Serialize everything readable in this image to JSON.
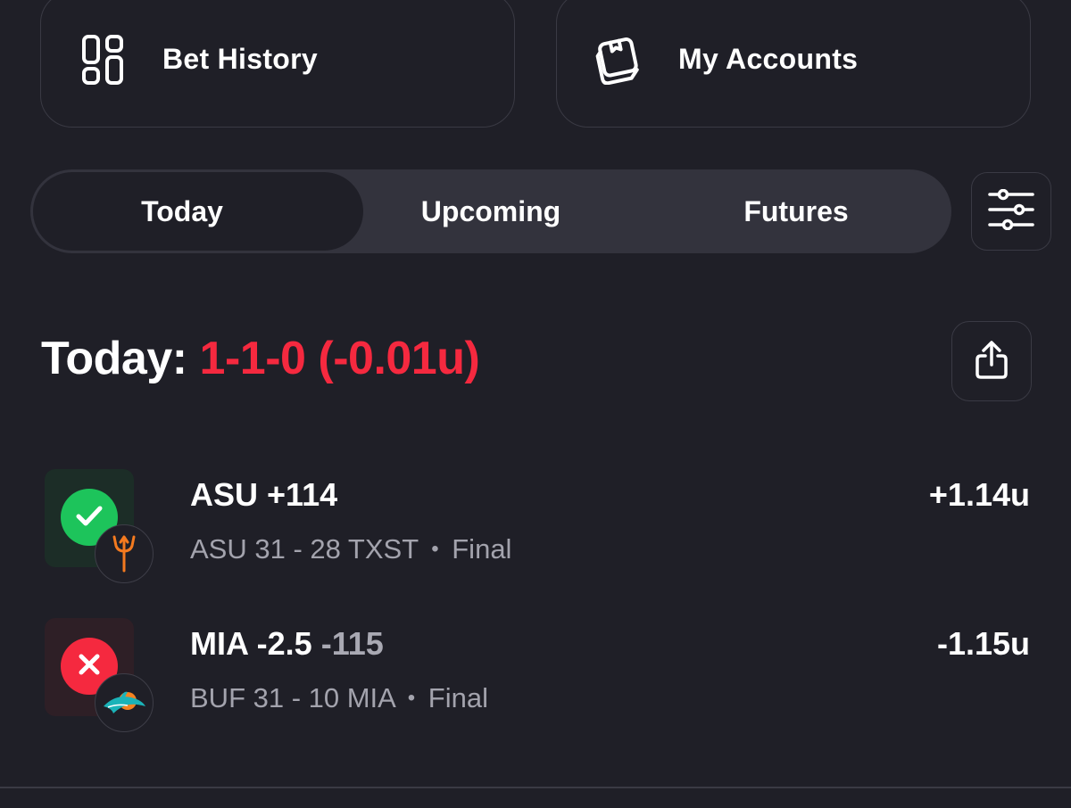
{
  "quick_links": {
    "bet_history_label": "Bet History",
    "my_accounts_label": "My Accounts",
    "bet_history_icon": "layout-grid-icon",
    "my_accounts_icon": "package-box-icon"
  },
  "tabs": {
    "items": [
      "Today",
      "Upcoming",
      "Futures"
    ],
    "active": "Today",
    "filter_icon": "sliders-icon"
  },
  "summary": {
    "label": "Today:",
    "record": "1-1-0 (-0.01u)",
    "share_icon": "share-icon"
  },
  "bets": [
    {
      "pick": "ASU +114",
      "pick_odds": "",
      "result_line": "ASU 31 - 28 TXST",
      "status": "Final",
      "units": "+1.14u",
      "outcome": "win",
      "outcome_icon": "check-icon",
      "team_logo": "asu-pitchfork-logo"
    },
    {
      "pick": "MIA -2.5 ",
      "pick_odds": "-115",
      "result_line": "BUF 31 - 10 MIA",
      "status": "Final",
      "units": "-1.15u",
      "outcome": "loss",
      "outcome_icon": "x-icon",
      "team_logo": "dolphins-logo"
    }
  ],
  "colors": {
    "background": "#1f1f27",
    "loss_red": "#f5293f",
    "win_green": "#1dc45b",
    "win_tile": "#1c2d27",
    "loss_tile": "#2e1f26"
  }
}
